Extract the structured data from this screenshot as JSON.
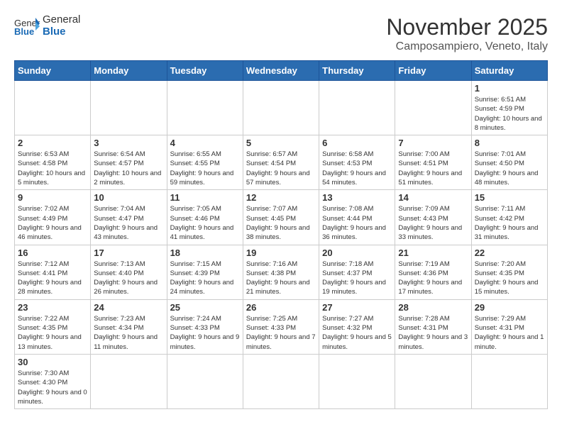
{
  "header": {
    "logo_general": "General",
    "logo_blue": "Blue",
    "month_title": "November 2025",
    "location": "Camposampiero, Veneto, Italy"
  },
  "weekdays": [
    "Sunday",
    "Monday",
    "Tuesday",
    "Wednesday",
    "Thursday",
    "Friday",
    "Saturday"
  ],
  "weeks": [
    [
      {
        "day": "",
        "info": ""
      },
      {
        "day": "",
        "info": ""
      },
      {
        "day": "",
        "info": ""
      },
      {
        "day": "",
        "info": ""
      },
      {
        "day": "",
        "info": ""
      },
      {
        "day": "",
        "info": ""
      },
      {
        "day": "1",
        "info": "Sunrise: 6:51 AM\nSunset: 4:59 PM\nDaylight: 10 hours and 8 minutes."
      }
    ],
    [
      {
        "day": "2",
        "info": "Sunrise: 6:53 AM\nSunset: 4:58 PM\nDaylight: 10 hours and 5 minutes."
      },
      {
        "day": "3",
        "info": "Sunrise: 6:54 AM\nSunset: 4:57 PM\nDaylight: 10 hours and 2 minutes."
      },
      {
        "day": "4",
        "info": "Sunrise: 6:55 AM\nSunset: 4:55 PM\nDaylight: 9 hours and 59 minutes."
      },
      {
        "day": "5",
        "info": "Sunrise: 6:57 AM\nSunset: 4:54 PM\nDaylight: 9 hours and 57 minutes."
      },
      {
        "day": "6",
        "info": "Sunrise: 6:58 AM\nSunset: 4:53 PM\nDaylight: 9 hours and 54 minutes."
      },
      {
        "day": "7",
        "info": "Sunrise: 7:00 AM\nSunset: 4:51 PM\nDaylight: 9 hours and 51 minutes."
      },
      {
        "day": "8",
        "info": "Sunrise: 7:01 AM\nSunset: 4:50 PM\nDaylight: 9 hours and 48 minutes."
      }
    ],
    [
      {
        "day": "9",
        "info": "Sunrise: 7:02 AM\nSunset: 4:49 PM\nDaylight: 9 hours and 46 minutes."
      },
      {
        "day": "10",
        "info": "Sunrise: 7:04 AM\nSunset: 4:47 PM\nDaylight: 9 hours and 43 minutes."
      },
      {
        "day": "11",
        "info": "Sunrise: 7:05 AM\nSunset: 4:46 PM\nDaylight: 9 hours and 41 minutes."
      },
      {
        "day": "12",
        "info": "Sunrise: 7:07 AM\nSunset: 4:45 PM\nDaylight: 9 hours and 38 minutes."
      },
      {
        "day": "13",
        "info": "Sunrise: 7:08 AM\nSunset: 4:44 PM\nDaylight: 9 hours and 36 minutes."
      },
      {
        "day": "14",
        "info": "Sunrise: 7:09 AM\nSunset: 4:43 PM\nDaylight: 9 hours and 33 minutes."
      },
      {
        "day": "15",
        "info": "Sunrise: 7:11 AM\nSunset: 4:42 PM\nDaylight: 9 hours and 31 minutes."
      }
    ],
    [
      {
        "day": "16",
        "info": "Sunrise: 7:12 AM\nSunset: 4:41 PM\nDaylight: 9 hours and 28 minutes."
      },
      {
        "day": "17",
        "info": "Sunrise: 7:13 AM\nSunset: 4:40 PM\nDaylight: 9 hours and 26 minutes."
      },
      {
        "day": "18",
        "info": "Sunrise: 7:15 AM\nSunset: 4:39 PM\nDaylight: 9 hours and 24 minutes."
      },
      {
        "day": "19",
        "info": "Sunrise: 7:16 AM\nSunset: 4:38 PM\nDaylight: 9 hours and 21 minutes."
      },
      {
        "day": "20",
        "info": "Sunrise: 7:18 AM\nSunset: 4:37 PM\nDaylight: 9 hours and 19 minutes."
      },
      {
        "day": "21",
        "info": "Sunrise: 7:19 AM\nSunset: 4:36 PM\nDaylight: 9 hours and 17 minutes."
      },
      {
        "day": "22",
        "info": "Sunrise: 7:20 AM\nSunset: 4:35 PM\nDaylight: 9 hours and 15 minutes."
      }
    ],
    [
      {
        "day": "23",
        "info": "Sunrise: 7:22 AM\nSunset: 4:35 PM\nDaylight: 9 hours and 13 minutes."
      },
      {
        "day": "24",
        "info": "Sunrise: 7:23 AM\nSunset: 4:34 PM\nDaylight: 9 hours and 11 minutes."
      },
      {
        "day": "25",
        "info": "Sunrise: 7:24 AM\nSunset: 4:33 PM\nDaylight: 9 hours and 9 minutes."
      },
      {
        "day": "26",
        "info": "Sunrise: 7:25 AM\nSunset: 4:33 PM\nDaylight: 9 hours and 7 minutes."
      },
      {
        "day": "27",
        "info": "Sunrise: 7:27 AM\nSunset: 4:32 PM\nDaylight: 9 hours and 5 minutes."
      },
      {
        "day": "28",
        "info": "Sunrise: 7:28 AM\nSunset: 4:31 PM\nDaylight: 9 hours and 3 minutes."
      },
      {
        "day": "29",
        "info": "Sunrise: 7:29 AM\nSunset: 4:31 PM\nDaylight: 9 hours and 1 minute."
      }
    ],
    [
      {
        "day": "30",
        "info": "Sunrise: 7:30 AM\nSunset: 4:30 PM\nDaylight: 9 hours and 0 minutes."
      },
      {
        "day": "",
        "info": ""
      },
      {
        "day": "",
        "info": ""
      },
      {
        "day": "",
        "info": ""
      },
      {
        "day": "",
        "info": ""
      },
      {
        "day": "",
        "info": ""
      },
      {
        "day": "",
        "info": ""
      }
    ]
  ]
}
